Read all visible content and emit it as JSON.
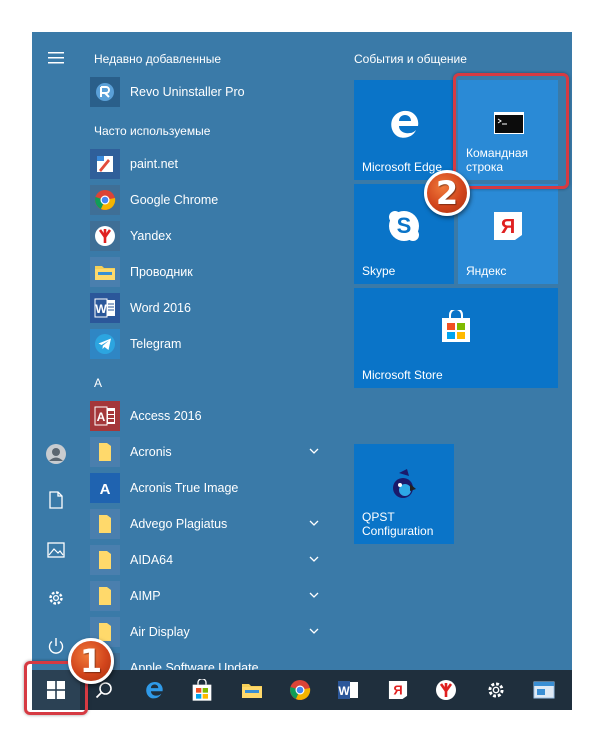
{
  "app_list": {
    "recently_added_header": "Недавно добавленные",
    "recent": [
      {
        "label": "Revo Uninstaller Pro",
        "icon": "revo-icon"
      }
    ],
    "frequent_header": "Часто используемые",
    "frequent": [
      {
        "label": "paint.net",
        "icon": "paintnet-icon"
      },
      {
        "label": "Google Chrome",
        "icon": "chrome-icon"
      },
      {
        "label": "Yandex",
        "icon": "yandex-browser-icon"
      },
      {
        "label": "Проводник",
        "icon": "folder-icon"
      },
      {
        "label": "Word 2016",
        "icon": "word-icon"
      },
      {
        "label": "Telegram",
        "icon": "telegram-icon"
      }
    ],
    "letter_header": "A",
    "alpha": [
      {
        "label": "Access 2016",
        "icon": "access-icon"
      },
      {
        "label": "Acronis",
        "icon": "folder-icon",
        "expandable": true
      },
      {
        "label": "Acronis True Image",
        "icon": "acronis-icon"
      },
      {
        "label": "Advego Plagiatus",
        "icon": "folder-icon",
        "expandable": true
      },
      {
        "label": "AIDA64",
        "icon": "folder-icon",
        "expandable": true
      },
      {
        "label": "AIMP",
        "icon": "folder-icon",
        "expandable": true
      },
      {
        "label": "Air Display",
        "icon": "folder-icon",
        "expandable": true
      },
      {
        "label": "Apple Software Update",
        "icon": "apple-update-icon"
      }
    ]
  },
  "tiles": {
    "group_header": "События и общение",
    "edge": "Microsoft Edge",
    "cmd": "Командная\nстрока",
    "skype": "Skype",
    "yandex": "Яндекс",
    "store": "Microsoft Store",
    "qpst": "QPST\nConfiguration"
  },
  "callouts": {
    "one": "1",
    "two": "2"
  },
  "colors": {
    "menu_bg": "#3a7aa8",
    "tile_bg": "#1b8fd6",
    "taskbar_bg": "#1f2f3d",
    "callout": "#d63a42"
  }
}
